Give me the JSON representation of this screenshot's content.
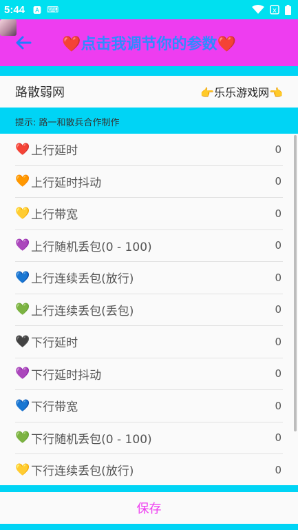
{
  "status_bar": {
    "time": "5:44"
  },
  "header": {
    "title": "❤️点击我调节你的参数❤️"
  },
  "network": {
    "label": "路散弱网",
    "value": "👉乐乐游戏网👈"
  },
  "hint": "提示: 路一和散兵合作制作",
  "items": [
    {
      "heart": "❤️",
      "heart_color": "#f08080",
      "label": "上行延时",
      "value": "0"
    },
    {
      "heart": "🧡",
      "heart_color": "#f5a04a",
      "label": "上行延时抖动",
      "value": "0"
    },
    {
      "heart": "💛",
      "heart_color": "#f5d040",
      "label": "上行带宽",
      "value": "0"
    },
    {
      "heart": "💜",
      "heart_color": "#a56ad6",
      "label": "上行随机丢包(0 - 100)",
      "value": "0"
    },
    {
      "heart": "💙",
      "heart_color": "#5aa8ec",
      "label": "上行连续丢包(放行)",
      "value": "0"
    },
    {
      "heart": "💚",
      "heart_color": "#8bc86a",
      "label": "上行连续丢包(丢包)",
      "value": "0"
    },
    {
      "heart": "🖤",
      "heart_color": "#6a6a6a",
      "label": "下行延时",
      "value": "0"
    },
    {
      "heart": "💜",
      "heart_color": "#a56ad6",
      "label": "下行延时抖动",
      "value": "0"
    },
    {
      "heart": "💙",
      "heart_color": "#5aa8ec",
      "label": "下行带宽",
      "value": "0"
    },
    {
      "heart": "💚",
      "heart_color": "#8bc86a",
      "label": "下行随机丢包(0 - 100)",
      "value": "0"
    },
    {
      "heart": "💛",
      "heart_color": "#f5d040",
      "label": "下行连续丢包(放行)",
      "value": "0"
    }
  ],
  "footer": {
    "save_label": "保存"
  },
  "colors": {
    "accent": "#ee3df0",
    "cyan": "#00d4f5",
    "back_arrow": "#1f7cff",
    "title": "#2e8bff"
  }
}
